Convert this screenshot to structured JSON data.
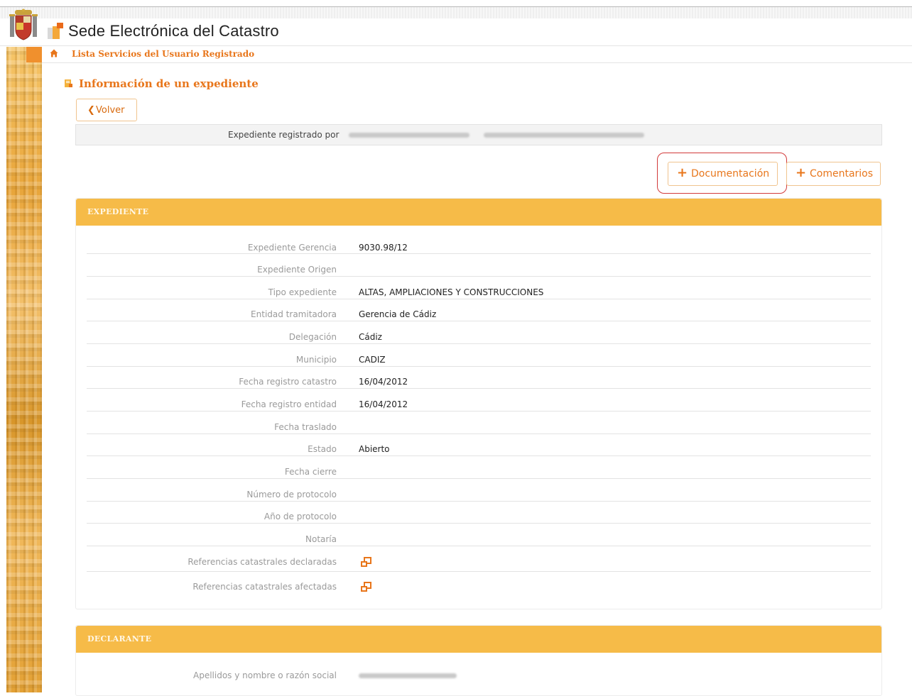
{
  "header": {
    "site_title": "Sede Electrónica del Catastro"
  },
  "nav": {
    "home_icon": "home-icon",
    "link_label": "Lista Servicios del Usuario Registrado"
  },
  "page": {
    "title": "Información de un expediente",
    "back_label": "Volver",
    "registered_by_label": "Expediente registrado por"
  },
  "actions": {
    "documentacion_label": "Documentación",
    "comentarios_label": "Comentarios"
  },
  "expediente": {
    "header": "EXPEDIENTE",
    "rows": [
      {
        "label": "Expediente Gerencia",
        "value": "9030.98/12"
      },
      {
        "label": "Expediente Origen",
        "value": ""
      },
      {
        "label": "Tipo expediente",
        "value": "ALTAS, AMPLIACIONES Y CONSTRUCCIONES"
      },
      {
        "label": "Entidad tramitadora",
        "value": "Gerencia de Cádiz"
      },
      {
        "label": "Delegación",
        "value": "Cádiz"
      },
      {
        "label": "Municipio",
        "value": "CADIZ"
      },
      {
        "label": "Fecha registro catastro",
        "value": "16/04/2012"
      },
      {
        "label": "Fecha registro entidad",
        "value": "16/04/2012"
      },
      {
        "label": "Fecha traslado",
        "value": ""
      },
      {
        "label": "Estado",
        "value": "Abierto"
      },
      {
        "label": "Fecha cierre",
        "value": ""
      },
      {
        "label": "Número de protocolo",
        "value": ""
      },
      {
        "label": "Año de protocolo",
        "value": ""
      },
      {
        "label": "Notaría",
        "value": ""
      },
      {
        "label": "Referencias catastrales declaradas",
        "value": ""
      },
      {
        "label": "Referencias catastrales afectadas",
        "value": ""
      }
    ]
  },
  "declarante": {
    "header": "DECLARANTE",
    "rows": [
      {
        "label": "Apellidos y nombre o razón social",
        "value": ""
      }
    ]
  },
  "colors": {
    "accent": "#e8761b",
    "panel_header": "#f6bb48",
    "highlight": "#d23a3a"
  }
}
